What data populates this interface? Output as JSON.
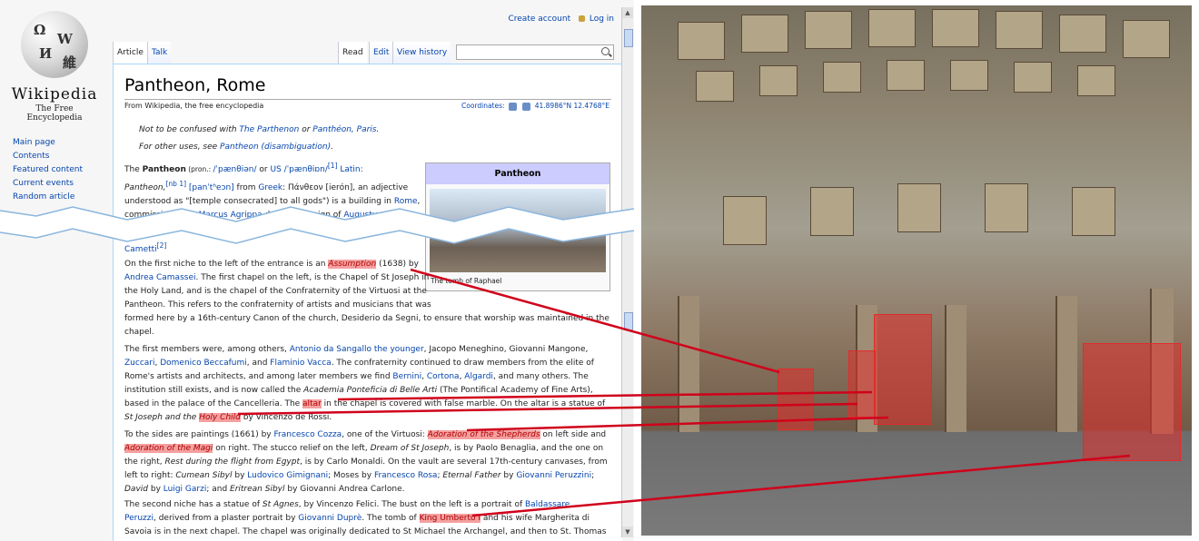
{
  "colors": {
    "link": "#0645ad",
    "highlight": "#f4a0a0",
    "connector": "#d0021b",
    "infobox_header": "#ccccff"
  },
  "personal": {
    "create_account": "Create account",
    "login": "Log in"
  },
  "logo": {
    "wordmark": "Wikipedia",
    "tagline": "The Free Encyclopedia"
  },
  "sidebar": {
    "items": [
      "Main page",
      "Contents",
      "Featured content",
      "Current events",
      "Random article"
    ]
  },
  "tabs": {
    "article": "Article",
    "talk": "Talk",
    "read": "Read",
    "edit": "Edit",
    "history": "View history"
  },
  "search": {
    "value": ""
  },
  "article": {
    "title": "Pantheon, Rome",
    "from": "From Wikipedia, the free encyclopedia",
    "coord_label": "Coordinates:",
    "coord_value": "41.8986°N 12.4768°E",
    "hatnote1": {
      "pre": "Not to be confused with ",
      "link1": "The Parthenon",
      "mid": " or ",
      "link2": "Panthéon, Paris",
      "post": "."
    },
    "hatnote2": {
      "pre": "For other uses, see ",
      "link": "Pantheon (disambiguation)",
      "post": "."
    },
    "p1": {
      "l1a": "The ",
      "bold": "Pantheon",
      "l1b": " (pron.: ",
      "ipa1": "/ˈpænθiən/",
      "l1c": " or ",
      "us": "US",
      "ipa2": " /ˈpænθiɒn/",
      "ref1": "[1]",
      "l1d": " Latin:",
      "l2a": "Pantheon,",
      "ref2": "[nb 1]",
      "l2b": " [panˈtʰeɔn]",
      "l2c": " from ",
      "greek": "Greek",
      "l2d": ": Πάνθεον [ierón], an adjective",
      "l3a": "understood as \"[temple consecrated] to all gods\") is a building in ",
      "rome": "Rome",
      "l3b": ",",
      "l4a": "commissioned by ",
      "agrippa": "Marcus Agrippa",
      "l4b": " during the reign of ",
      "augustus": "Augustus",
      "l4c": " as"
    },
    "cameti": "Cametti",
    "cameti_ref": "[2]",
    "infobox": {
      "title": "Pantheon",
      "caption": "The tomb of Raphael"
    },
    "p2": {
      "a": "On the first niche to the left of the entrance is an ",
      "h_assumption": "Assumption",
      "b": " (1638) by",
      "c": "Andrea Camassei",
      "d": ". The first chapel on the left, is the Chapel of St Joseph in",
      "e": "the Holy Land, and is the chapel of the Confraternity of the Virtuosi at the",
      "f": "Pantheon. This refers to the confraternity of artists and musicians that was",
      "g": "formed here by a 16th-century Canon of the church, Desiderio da Segni, to ensure that worship was maintained in the",
      "h": "chapel."
    },
    "p3": {
      "a": "The first members were, among others, ",
      "sangallo": "Antonio da Sangallo the younger",
      "b": ", Jacopo Meneghino, Giovanni Mangone,",
      "zuccari": "Zuccari",
      "c": ", ",
      "beccafumi": "Domenico Beccafumi",
      "d": ", and ",
      "vacca": "Flaminio Vacca",
      "e": ". The confraternity continued to draw members from the elite of",
      "f": "Rome's artists and architects, and among later members we find ",
      "bernini": "Bernini",
      "g": ", ",
      "cortona": "Cortona",
      "h": ", ",
      "algardi": "Algardi",
      "i": ", and many others. The",
      "j": "institution still exists, and is now called the ",
      "accademia": "Academia Ponteficia di Belle Arti",
      "k": " (The Pontifical Academy of Fine Arts),",
      "l": "based in the palace of the Cancelleria. The ",
      "h_altar": "altar",
      "m": " in the chapel is covered with false marble. On the altar is a statue of",
      "n": "St Joseph and the ",
      "h_child": "Holy Child",
      "o": " by Vincenzo de Rossi."
    },
    "p4": {
      "a": "To the sides are paintings (1661) by ",
      "cozza": "Francesco Cozza",
      "b": ", one of the Virtuosi: ",
      "h_shepherds": "Adoration of the Shepherds",
      "c": " on left side and",
      "h_magi": "Adoration of the Magi",
      "d": " on right. The stucco relief on the left, ",
      "dream": "Dream of St Joseph",
      "e": ", is by Paolo Benaglia, and the one on",
      "f": "the right, ",
      "rest": "Rest during the flight from Egypt",
      "g": ", is by Carlo Monaldi. On the vault are several 17th-century canvases, from",
      "h": "left to right: ",
      "cumean": "Cumean Sibyl",
      "i": " by ",
      "gimignani": "Ludovico Gimignani",
      "j": "; Moses by ",
      "rosa": "Francesco Rosa",
      "k": "; ",
      "eternal": "Eternal Father",
      "l": " by ",
      "peruzzini": "Giovanni Peruzzini",
      "m": ";",
      "david": "David",
      "n": " by ",
      "garzi": "Luigi Garzi",
      "o": "; and ",
      "eritrean": "Eritrean Sibyl",
      "p": " by Giovanni Andrea Carlone."
    },
    "p5": {
      "a": "The second niche has a statue of ",
      "agnes": "St Agnes",
      "b": ", by Vincenzo Felici. The bust on the left is a portrait of ",
      "baldassare": "Baldassare",
      "peruzzi": "Peruzzi",
      "c": ", derived from a plaster portrait by ",
      "dupre": "Giovanni Duprè",
      "d": ". The tomb of ",
      "h_umberto": "King Umberto I",
      "e": " and his wife Margherita di",
      "f": "Savoia is in the next chapel. The chapel was originally dedicated to St Michael the Archangel, and then to St. Thomas"
    }
  }
}
